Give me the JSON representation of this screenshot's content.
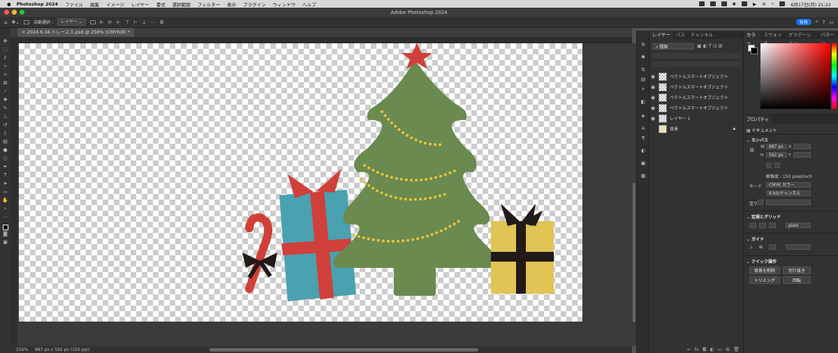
{
  "menubar": {
    "app": "Photoshop 2024",
    "items": [
      "ファイル",
      "編集",
      "イメージ",
      "レイヤー",
      "書式",
      "選択範囲",
      "フィルター",
      "表示",
      "プラグイン",
      "ウィンドウ",
      "ヘルプ"
    ],
    "datetime": "6月17日(月) 21:22"
  },
  "window": {
    "title": "Adobe Photoshop 2024"
  },
  "options": {
    "auto_select_label": "自動選択 :",
    "auto_select_value": "レイヤー",
    "share_button": "共有"
  },
  "document": {
    "tab_title": "2024.6.16.トレース３.psd @ 256% (CMYK/8) *",
    "zoom": "256%",
    "size_info": "887 px x 592 px (150 ppi)"
  },
  "layers_panel": {
    "tabs": [
      "レイヤー",
      "パス",
      "チャンネル"
    ],
    "filter_label": "種類",
    "layers": [
      {
        "name": "ベクトルスマートオブジェクト"
      },
      {
        "name": "ベクトルスマートオブジェクト"
      },
      {
        "name": "ベクトルスマートオブジェクト"
      },
      {
        "name": "ベクトルスマートオブジェクト"
      },
      {
        "name": "レイヤー 1"
      },
      {
        "name": "背景"
      }
    ]
  },
  "color_panel": {
    "tabs": [
      "カラー",
      "スウォッチ",
      "グラデーション",
      "パターン"
    ]
  },
  "properties": {
    "title": "プロパティ",
    "doc_label": "ドキュメント",
    "canvas_label": "カンバス",
    "w_label": "W",
    "w_value": "887 px",
    "h_label": "H",
    "h_value": "592 px",
    "x_label": "X",
    "y_label": "Y",
    "resolution": "解像度 : 150 pixel/inch",
    "mode_label": "モード",
    "mode_value": "CMYK カラー",
    "bits_value": "8 bit/チャンネル",
    "fill_label": "塗り",
    "rulers_label": "定規とグリッド",
    "units_value": "pixel",
    "guides_label": "ガイド",
    "quick_label": "クイック操作",
    "btn_trim_bg": "背景を削除",
    "btn_crop": "切り抜き",
    "btn_trimming": "トリミング",
    "btn_rotate": "回転"
  },
  "colors": {
    "tree": "#6a8a4f",
    "star": "#d0403a",
    "garland": "#e8c23c",
    "box_blue": "#4aa1b0",
    "ribbon_red": "#d0403a",
    "box_yellow": "#e0c454",
    "ribbon_black": "#221a18"
  }
}
